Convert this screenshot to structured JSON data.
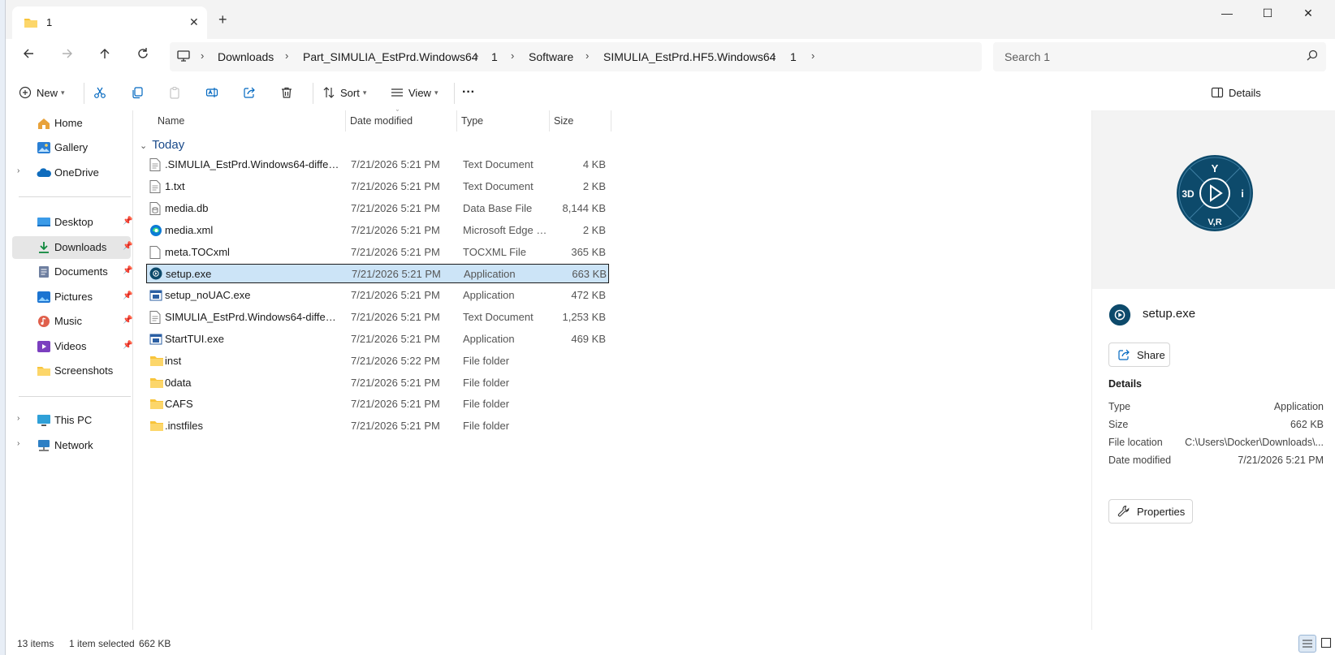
{
  "window": {
    "tab_title": "1",
    "tab_close": "✕",
    "new_tab": "+",
    "minimize": "—",
    "maximize": "☐",
    "close": "✕"
  },
  "address": {
    "crumbs": [
      "Downloads",
      "Part_SIMULIA_EstPrd.Windows64",
      "1",
      "Software",
      "SIMULIA_EstPrd.HF5.Windows64",
      "1"
    ],
    "search_placeholder": "Search 1"
  },
  "toolbar": {
    "new_label": "New",
    "sort_label": "Sort",
    "view_label": "View",
    "more_label": "···",
    "details_label": "Details"
  },
  "sidebar": {
    "items": [
      {
        "label": "Home"
      },
      {
        "label": "Gallery"
      },
      {
        "label": "OneDrive"
      },
      {
        "label": "Desktop"
      },
      {
        "label": "Downloads"
      },
      {
        "label": "Documents"
      },
      {
        "label": "Pictures"
      },
      {
        "label": "Music"
      },
      {
        "label": "Videos"
      },
      {
        "label": "Screenshots"
      },
      {
        "label": "This PC"
      },
      {
        "label": "Network"
      }
    ]
  },
  "files": {
    "columns": {
      "name": "Name",
      "date": "Date modified",
      "type": "Type",
      "size": "Size"
    },
    "group_label": "Today",
    "rows": [
      {
        "name": ".SIMULIA_EstPrd.Windows64-differences...",
        "date": "7/21/2026 5:21 PM",
        "type": "Text Document",
        "size": "4 KB"
      },
      {
        "name": "1.txt",
        "date": "7/21/2026 5:21 PM",
        "type": "Text Document",
        "size": "2 KB"
      },
      {
        "name": "media.db",
        "date": "7/21/2026 5:21 PM",
        "type": "Data Base File",
        "size": "8,144 KB"
      },
      {
        "name": "media.xml",
        "date": "7/21/2026 5:21 PM",
        "type": "Microsoft Edge H...",
        "size": "2 KB"
      },
      {
        "name": "meta.TOCxml",
        "date": "7/21/2026 5:21 PM",
        "type": "TOCXML File",
        "size": "365 KB"
      },
      {
        "name": "setup.exe",
        "date": "7/21/2026 5:21 PM",
        "type": "Application",
        "size": "663 KB"
      },
      {
        "name": "setup_noUAC.exe",
        "date": "7/21/2026 5:21 PM",
        "type": "Application",
        "size": "472 KB"
      },
      {
        "name": "SIMULIA_EstPrd.Windows64-differences-...",
        "date": "7/21/2026 5:21 PM",
        "type": "Text Document",
        "size": "1,253 KB"
      },
      {
        "name": "StartTUI.exe",
        "date": "7/21/2026 5:21 PM",
        "type": "Application",
        "size": "469 KB"
      },
      {
        "name": "inst",
        "date": "7/21/2026 5:22 PM",
        "type": "File folder",
        "size": ""
      },
      {
        "name": "0data",
        "date": "7/21/2026 5:21 PM",
        "type": "File folder",
        "size": ""
      },
      {
        "name": "CAFS",
        "date": "7/21/2026 5:21 PM",
        "type": "File folder",
        "size": ""
      },
      {
        "name": ".instfiles",
        "date": "7/21/2026 5:21 PM",
        "type": "File folder",
        "size": ""
      }
    ]
  },
  "details": {
    "filename": "setup.exe",
    "share_label": "Share",
    "section_label": "Details",
    "props": [
      {
        "key": "Type",
        "value": "Application"
      },
      {
        "key": "Size",
        "value": "662 KB"
      },
      {
        "key": "File location",
        "value": "C:\\Users\\Docker\\Downloads\\..."
      },
      {
        "key": "Date modified",
        "value": "7/21/2026 5:21 PM"
      }
    ],
    "properties_label": "Properties",
    "logo_text": {
      "top": "Y",
      "left": "3D",
      "right": "i",
      "bottom": "V,R"
    }
  },
  "status": {
    "items_count": "13 items",
    "selected": "1 item selected",
    "selected_size": "662 KB"
  },
  "colors": {
    "selection": "#cce4f7",
    "accent": "#0067c0",
    "folder": "#f8c43a",
    "logo": "#0d4a6b"
  }
}
